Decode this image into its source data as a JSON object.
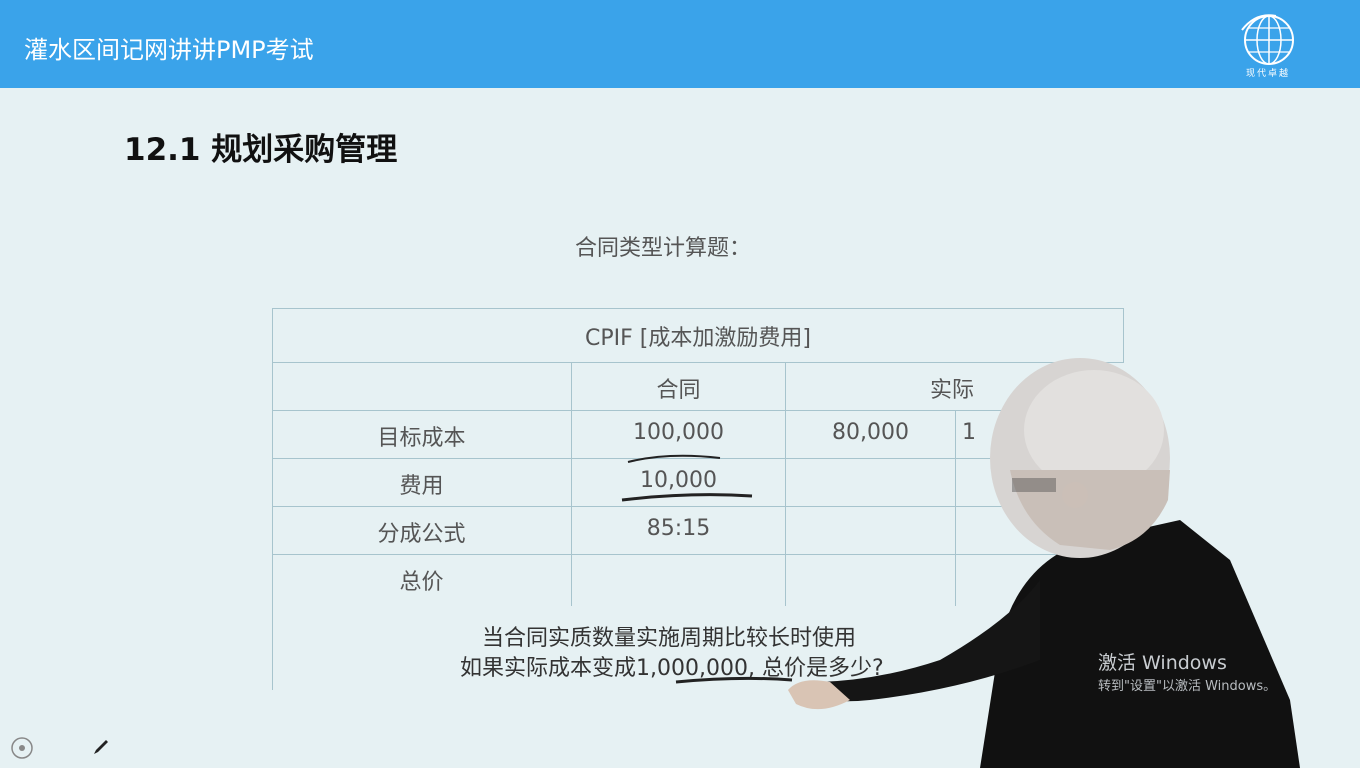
{
  "banner": {
    "title": "灌水区间记网讲讲PMP考试",
    "logo_text": "现代卓越",
    "logo_icon": "globe-icon",
    "bg_color": "#3aa3ea"
  },
  "slide": {
    "title": "12.1 规划采购管理",
    "subtitle": "合同类型计算题：",
    "table": {
      "caption": "CPIF [成本加激励费用]",
      "headers": [
        "合同",
        "实际"
      ],
      "rows": [
        {
          "label": "目标成本",
          "contract": "100,000",
          "actual": "80,000",
          "extra": "1"
        },
        {
          "label": "费用",
          "contract": "10,000",
          "actual": "",
          "extra": ""
        },
        {
          "label": "分成公式",
          "contract": "85:15",
          "actual": "",
          "extra": ""
        },
        {
          "label": "总价",
          "contract": "",
          "actual": "",
          "extra": ""
        }
      ]
    },
    "note_line1": "当合同实质数量实施周期比较长时使用",
    "note_line2": "如果实际成本变成1,000,000, 总价是多少?"
  },
  "watermark": {
    "line1": "激活 Windows",
    "line2": "转到\"设置\"以激活 Windows。"
  },
  "controls": {
    "left_icon": "target-icon",
    "pen_icon": "pen-icon"
  }
}
